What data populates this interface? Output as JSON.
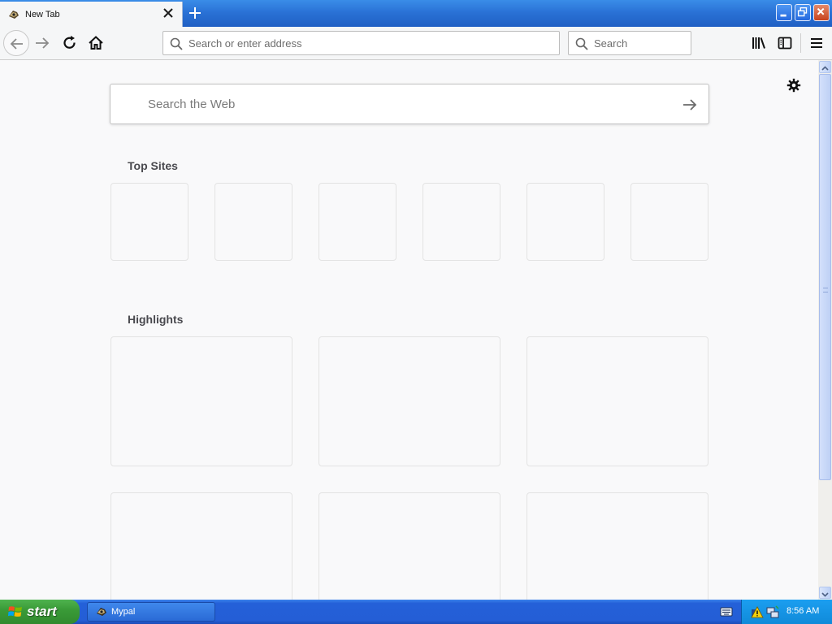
{
  "browser": {
    "tab_title": "New Tab",
    "url_placeholder": "Search or enter address",
    "search_placeholder": "Search"
  },
  "newtab": {
    "web_search_placeholder": "Search the Web",
    "top_sites_title": "Top Sites",
    "highlights_title": "Highlights"
  },
  "taskbar": {
    "start_label": "start",
    "task_label": "Mypal",
    "clock": "8:56 AM"
  },
  "icons": {
    "tab_favicon": "mypal-favicon-icon",
    "close": "close-icon",
    "new_tab": "plus-icon",
    "back": "arrow-left-icon",
    "forward": "arrow-right-icon",
    "reload": "reload-icon",
    "home": "home-icon",
    "search": "magnifier-icon",
    "library": "library-icon",
    "sidebar": "sidebar-icon",
    "menu": "hamburger-icon",
    "settings": "gear-icon"
  },
  "colors": {
    "titlebar": "#2a72d6",
    "toolbar": "#f5f6f7",
    "content_bg": "#f9f9fa",
    "start_green": "#3a9b38",
    "taskbar_blue": "#245ed6"
  }
}
